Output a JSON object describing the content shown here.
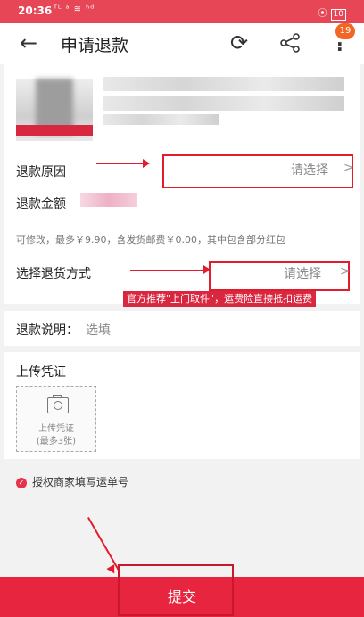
{
  "status_bar": {
    "time": "20:36",
    "signal": "°ıl °ıl ≈ ĥdа",
    "battery": "10"
  },
  "header": {
    "title": "申请退款",
    "badge_count": "19",
    "back_icon": "back-arrow-icon",
    "refresh_icon": "refresh-icon",
    "share_icon": "share-icon",
    "more_icon": "more-vertical-icon"
  },
  "form": {
    "refund_reason_label": "退款原因",
    "refund_reason_placeholder": "请选择",
    "refund_amount_label": "退款金额",
    "refund_hint": "可修改，最多￥9.90，含发货邮费￥0.00，其中包含部分红包",
    "return_method_label": "选择退货方式",
    "return_method_placeholder": "请选择",
    "promo_text": "官方推荐\"上门取件\"，运费险直接抵扣运费",
    "description_label": "退款说明：",
    "description_placeholder": "选填"
  },
  "upload": {
    "title": "上传凭证",
    "box_label_line1": "上传凭证",
    "box_label_line2": "(最多3张)"
  },
  "authorize": {
    "label": "授权商家填写运单号"
  },
  "footer": {
    "submit_label": "提交"
  },
  "colors": {
    "accent": "#e8253e",
    "annotation": "#e21b2d",
    "badge": "#f26522"
  }
}
